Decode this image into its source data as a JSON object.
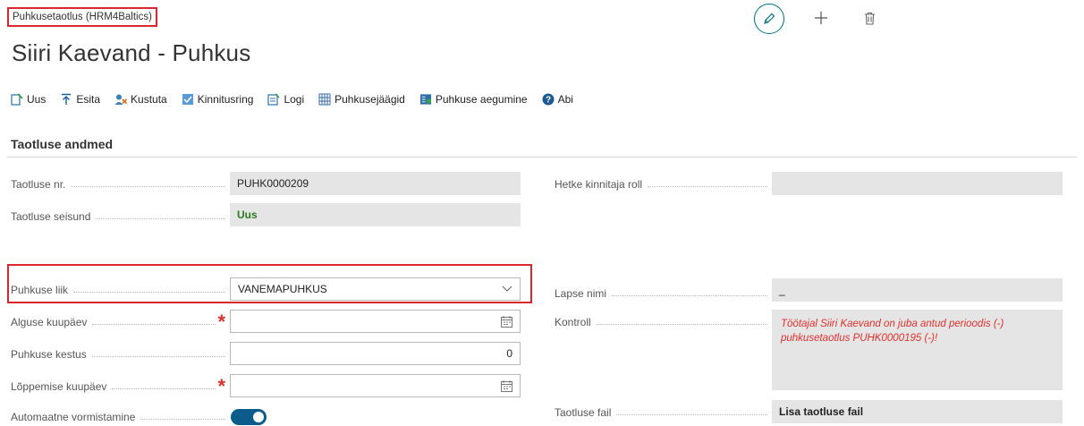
{
  "breadcrumb": "Puhkusetaotlus (HRM4Baltics)",
  "title": "Siiri Kaevand - Puhkus",
  "header_actions": {
    "edit_icon": "pencil-icon",
    "new_icon": "plus-icon",
    "delete_icon": "trash-icon"
  },
  "toolbar": [
    {
      "label": "Uus",
      "icon": "new-doc-icon"
    },
    {
      "label": "Esita",
      "icon": "upload-icon"
    },
    {
      "label": "Kustuta",
      "icon": "delete-user-icon"
    },
    {
      "label": "Kinnitusring",
      "icon": "approval-icon"
    },
    {
      "label": "Logi",
      "icon": "log-icon"
    },
    {
      "label": "Puhkusejäägid",
      "icon": "grid-icon"
    },
    {
      "label": "Puhkuse aegumine",
      "icon": "expiry-icon"
    },
    {
      "label": "Abi",
      "icon": "help-icon"
    }
  ],
  "section_title": "Taotluse andmed",
  "fields": {
    "taotluse_nr": {
      "label": "Taotluse nr.",
      "value": "PUHK0000209"
    },
    "taotluse_seisund": {
      "label": "Taotluse seisund",
      "value": "Uus"
    },
    "puhkuse_liik": {
      "label": "Puhkuse liik",
      "value": "VANEMAPUHKUS"
    },
    "alguse_kuupaev": {
      "label": "Alguse kuupäev",
      "value": ""
    },
    "puhkuse_kestus": {
      "label": "Puhkuse kestus",
      "value": "0"
    },
    "loppemise_kuupaev": {
      "label": "Lõppemise kuupäev",
      "value": ""
    },
    "automaatne_vormistamine": {
      "label": "Automaatne vormistamine",
      "value": true
    },
    "hetke_kinnitaja_roll": {
      "label": "Hetke kinnitaja roll",
      "value": ""
    },
    "lapse_nimi": {
      "label": "Lapse nimi",
      "value": "_"
    },
    "kontroll": {
      "label": "Kontroll",
      "value": "Töötajal Siiri Kaevand on juba antud perioodis (-) puhkusetaotlus PUHK0000195 (-)!"
    },
    "taotluse_fail": {
      "label": "Taotluse fail",
      "value": "Lisa taotluse fail"
    }
  },
  "colors": {
    "accent": "#00707a",
    "highlight": "#d9262f",
    "status_new": "#2c7a1f",
    "warning": "#e0302c",
    "toggle_on": "#0b5c8a"
  }
}
